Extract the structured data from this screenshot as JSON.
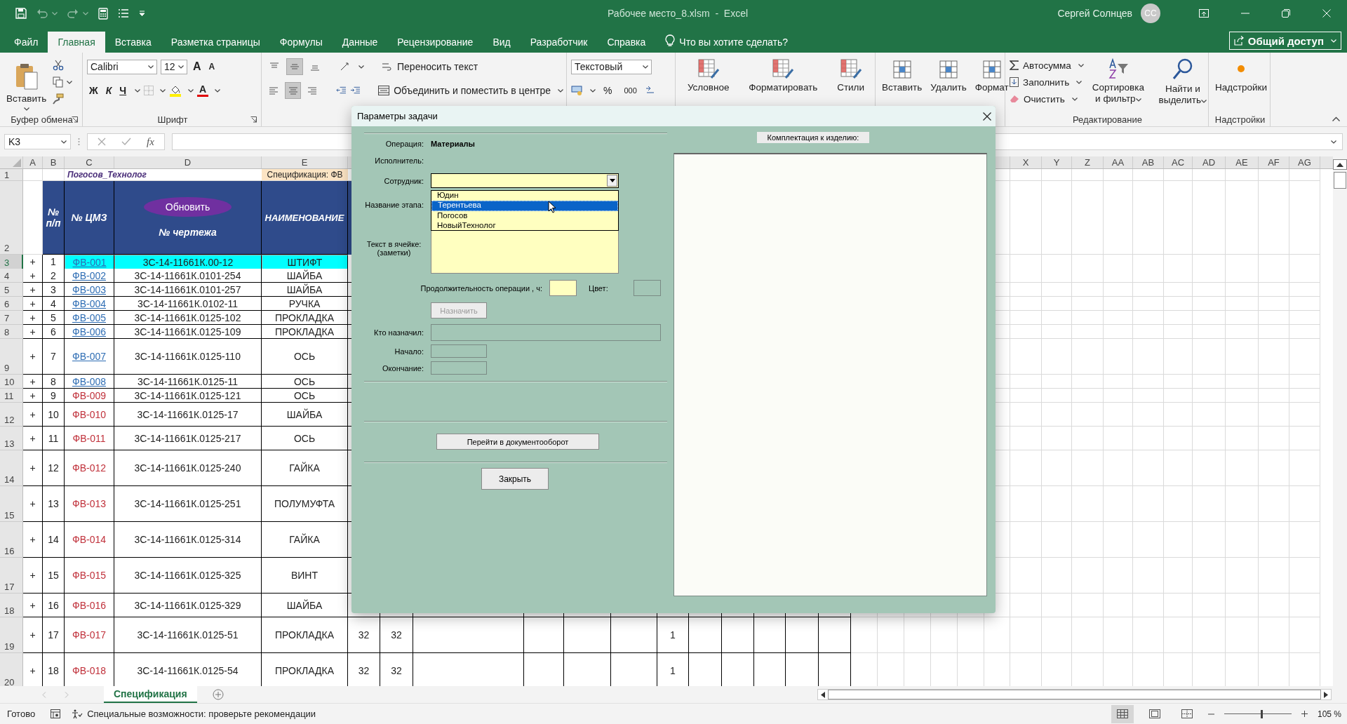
{
  "title_bar": {
    "document": "Рабочее место_8.xlsm  -  Excel",
    "user": "Сергей Солнцев",
    "avatar": "СС"
  },
  "menu_tabs": [
    {
      "label": "Файл",
      "selected": false
    },
    {
      "label": "Главная",
      "selected": true
    },
    {
      "label": "Вставка",
      "selected": false
    },
    {
      "label": "Разметка страницы",
      "selected": false
    },
    {
      "label": "Формулы",
      "selected": false
    },
    {
      "label": "Данные",
      "selected": false
    },
    {
      "label": "Рецензирование",
      "selected": false
    },
    {
      "label": "Вид",
      "selected": false
    },
    {
      "label": "Разработчик",
      "selected": false
    },
    {
      "label": "Справка",
      "selected": false
    }
  ],
  "tell_me": "Что вы хотите сделать?",
  "share": "Общий доступ",
  "ribbon": {
    "groups": [
      {
        "kind": "clipboard",
        "label": "Буфер обмена",
        "paste": "Вставить"
      },
      {
        "kind": "font",
        "label": "Шрифт",
        "font": "Calibri",
        "size": "12",
        "grow": "A",
        "shrink": "A",
        "bold": "Ж",
        "italic": "К",
        "underline": "Ч",
        "font_color": "A"
      },
      {
        "kind": "alignment",
        "wrap": "Переносить текст",
        "merge": "Объединить и поместить в центре",
        "vertical_align": [
          {
            "selected": false
          },
          {
            "selected": true
          },
          {
            "selected": false
          }
        ],
        "horizontal_align": [
          {
            "selected": false
          },
          {
            "selected": true
          },
          {
            "selected": false
          }
        ]
      },
      {
        "kind": "number",
        "format": "Текстовый",
        "percent": "%",
        "thousands": "000"
      },
      {
        "kind": "large_buttons",
        "buttons": [
          "Условное",
          "Форматировать",
          "Стили"
        ]
      },
      {
        "kind": "cells",
        "buttons": [
          "Вставить",
          "Удалить",
          "Формат"
        ]
      },
      {
        "kind": "editing",
        "label": "Редактирование",
        "small": [
          "Автосумма",
          "Заполнить",
          "Очистить"
        ],
        "large": [
          "Сортировка и фильтр",
          "Найти и выделить"
        ]
      },
      {
        "kind": "addins",
        "label": "Надстройки",
        "button": "Надстройки"
      }
    ]
  },
  "formula_bar": {
    "name_box": "K3",
    "fx": "fx"
  },
  "sheet": {
    "column_headers": [
      "A",
      "B",
      "C",
      "D",
      "E",
      "X",
      "Y",
      "Z",
      "AA",
      "AB",
      "AC",
      "AD",
      "AE",
      "AF",
      "AG"
    ],
    "row1": {
      "row": "1",
      "c": "Погосов_Технолог",
      "e": "Спецификация: ФВ"
    },
    "row2": {
      "row": "2",
      "b": "№ п/п",
      "c": "№ ЦМЗ",
      "d": "№ чертежа",
      "e": "НАИМЕНОВАНИЕ",
      "button": "Обновить"
    },
    "rows": [
      {
        "row": "3",
        "a": "+",
        "b": "1",
        "c": "ФВ-001",
        "c_link": true,
        "d": "3С-14-11661К.00-12",
        "e": "ШТИФТ",
        "selected": true
      },
      {
        "row": "4",
        "a": "+",
        "b": "2",
        "c": "ФВ-002",
        "c_link": true,
        "d": "3С-14-11661К.0101-254",
        "e": "ШАЙБА",
        "selected": false
      },
      {
        "row": "5",
        "a": "+",
        "b": "3",
        "c": "ФВ-003",
        "c_link": true,
        "d": "3С-14-11661К.0101-257",
        "e": "ШАЙБА",
        "selected": false
      },
      {
        "row": "6",
        "a": "+",
        "b": "4",
        "c": "ФВ-004",
        "c_link": true,
        "d": "3С-14-11661К.0102-11",
        "e": "РУЧКА",
        "selected": false
      },
      {
        "row": "7",
        "a": "+",
        "b": "5",
        "c": "ФВ-005",
        "c_link": true,
        "d": "3С-14-11661К.0125-102",
        "e": "ПРОКЛАДКА",
        "selected": false
      },
      {
        "row": "8",
        "a": "+",
        "b": "6",
        "c": "ФВ-006",
        "c_link": true,
        "d": "3С-14-11661К.0125-109",
        "e": "ПРОКЛАДКА",
        "selected": false
      },
      {
        "row": "9",
        "a": "+",
        "b": "7",
        "c": "ФВ-007",
        "c_link": true,
        "d": "3С-14-11661К.0125-110",
        "e": "ОСЬ",
        "selected": false
      },
      {
        "row": "10",
        "a": "+",
        "b": "8",
        "c": "ФВ-008",
        "c_link": true,
        "d": "3С-14-11661К.0125-11",
        "e": "ОСЬ",
        "selected": false
      },
      {
        "row": "11",
        "a": "+",
        "b": "9",
        "c": "ФВ-009",
        "c_link": false,
        "d": "3С-14-11661К.0125-121",
        "e": "ОСЬ",
        "selected": false
      },
      {
        "row": "12",
        "a": "+",
        "b": "10",
        "c": "ФВ-010",
        "c_link": false,
        "d": "3С-14-11661К.0125-17",
        "e": "ШАЙБА",
        "selected": false
      },
      {
        "row": "13",
        "a": "+",
        "b": "11",
        "c": "ФВ-011",
        "c_link": false,
        "d": "3С-14-11661К.0125-217",
        "e": "ОСЬ",
        "selected": false
      },
      {
        "row": "14",
        "a": "+",
        "b": "12",
        "c": "ФВ-012",
        "c_link": false,
        "d": "3С-14-11661К.0125-240",
        "e": "ГАЙКА",
        "selected": false
      },
      {
        "row": "15",
        "a": "+",
        "b": "13",
        "c": "ФВ-013",
        "c_link": false,
        "d": "3С-14-11661К.0125-251",
        "e": "ПОЛУМУФТА",
        "selected": false
      },
      {
        "row": "16",
        "a": "+",
        "b": "14",
        "c": "ФВ-014",
        "c_link": false,
        "d": "3С-14-11661К.0125-314",
        "e": "ГАЙКА",
        "selected": false
      },
      {
        "row": "17",
        "a": "+",
        "b": "15",
        "c": "ФВ-015",
        "c_link": false,
        "d": "3С-14-11661К.0125-325",
        "e": "ВИНТ",
        "selected": false
      },
      {
        "row": "18",
        "a": "+",
        "b": "16",
        "c": "ФВ-016",
        "c_link": false,
        "d": "3С-14-11661К.0125-329",
        "e": "ШАЙБА",
        "selected": false
      },
      {
        "row": "19",
        "a": "+",
        "b": "17",
        "c": "ФВ-017",
        "c_link": false,
        "d": "3С-14-11661К.0125-51",
        "e": "ПРОКЛАДКА",
        "f": "32",
        "g": "32",
        "l": "1",
        "selected": false
      },
      {
        "row": "20",
        "a": "+",
        "b": "18",
        "c": "ФВ-018",
        "c_link": false,
        "d": "3С-14-11661К.0125-54",
        "e": "ПРОКЛАДКА",
        "f": "32",
        "g": "32",
        "l": "1",
        "selected": false
      }
    ]
  },
  "sheet_tabs": [
    {
      "label": "Спецификация",
      "selected": true
    }
  ],
  "status_bar": {
    "ready": "Готово",
    "accessibility": "Специальные возможности: проверьте рекомендации",
    "view_modes": [
      {
        "selected": true
      },
      {
        "selected": false
      },
      {
        "selected": false
      }
    ],
    "zoom": {
      "level": 0.55,
      "reading": "105 %"
    }
  },
  "dialog": {
    "title": "Параметры задачи",
    "operation": {
      "label": "Операция:",
      "value": "Материалы"
    },
    "executor": {
      "label": "Исполнитель:"
    },
    "employee": {
      "label": "Сотрудник:",
      "expanded": true,
      "options": [
        {
          "label": "Юдин",
          "selected": false
        },
        {
          "label": "Терентьева",
          "selected": true
        },
        {
          "label": "Погосов",
          "selected": false
        },
        {
          "label": "НовыйТехнолог",
          "selected": false
        }
      ]
    },
    "stage": {
      "label": "Название этапа:"
    },
    "notes": {
      "label_lines": [
        "Текст в ячейке:",
        "(заметки)"
      ]
    },
    "duration": {
      "label": "Продолжительность операции , ч:"
    },
    "color": {
      "label": "Цвет:"
    },
    "assign": {
      "label": "Назначить",
      "disabled": true
    },
    "assigned_by": {
      "label": "Кто назначил:"
    },
    "start": {
      "label": "Начало:"
    },
    "end": {
      "label": "Окончание:"
    },
    "docflow_button": "Перейти в документооборот",
    "close_button": "Закрыть",
    "kit": {
      "label": "Комплектация к изделию:"
    }
  }
}
